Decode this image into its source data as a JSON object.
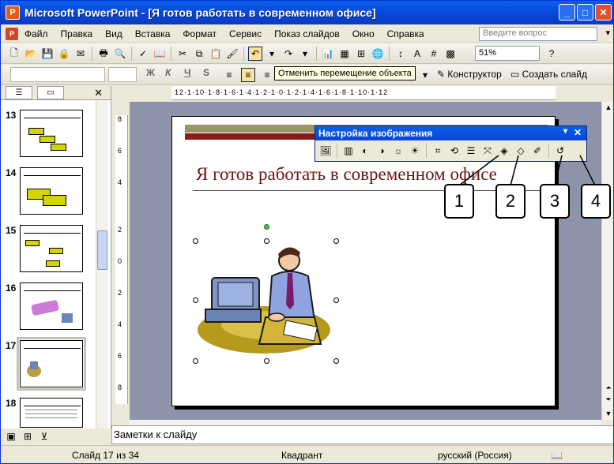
{
  "window": {
    "app_icon": "P",
    "title": "Microsoft PowerPoint - [Я готов работать в современном офисе]"
  },
  "window_buttons": {
    "minimize": "_",
    "maximize": "□",
    "close": "✕"
  },
  "menu": {
    "items": [
      "Файл",
      "Правка",
      "Вид",
      "Вставка",
      "Формат",
      "Сервис",
      "Показ слайдов",
      "Окно",
      "Справка"
    ],
    "help_placeholder": "Введите вопрос",
    "help_drop": "▾",
    "close": "✕"
  },
  "toolbar": {
    "zoom": "51%",
    "tooltip": "Отменить перемещение объекта",
    "constructor": "Конструктор",
    "new_slide": "Создать слайд",
    "font_bold": "Ж",
    "font_italic": "К",
    "font_underline": "Ч",
    "font_shadow": "S"
  },
  "slides_pane": {
    "close": "✕",
    "thumbs": [
      {
        "num": "13"
      },
      {
        "num": "14"
      },
      {
        "num": "15"
      },
      {
        "num": "16"
      },
      {
        "num": "17"
      },
      {
        "num": "18"
      }
    ]
  },
  "ruler": {
    "horizontal": "12·1·10·1·8·1·6·1·4·1·2·1·0·1·2·1·4·1·6·1·8·1·10·1·12"
  },
  "vruler": [
    "8",
    "6",
    "4",
    "2",
    "0",
    "2",
    "4",
    "6",
    "8"
  ],
  "slide": {
    "title": "Я готов работать в современном офисе"
  },
  "picture_toolbar": {
    "title": "Настройка изображения",
    "close": "✕",
    "drop": "▾"
  },
  "callouts": [
    "1",
    "2",
    "3",
    "4"
  ],
  "notes": {
    "placeholder": "Заметки к слайду"
  },
  "status": {
    "slide": "Слайд 17 из 34",
    "design": "Квадрант",
    "language": "русский (Россия)"
  }
}
